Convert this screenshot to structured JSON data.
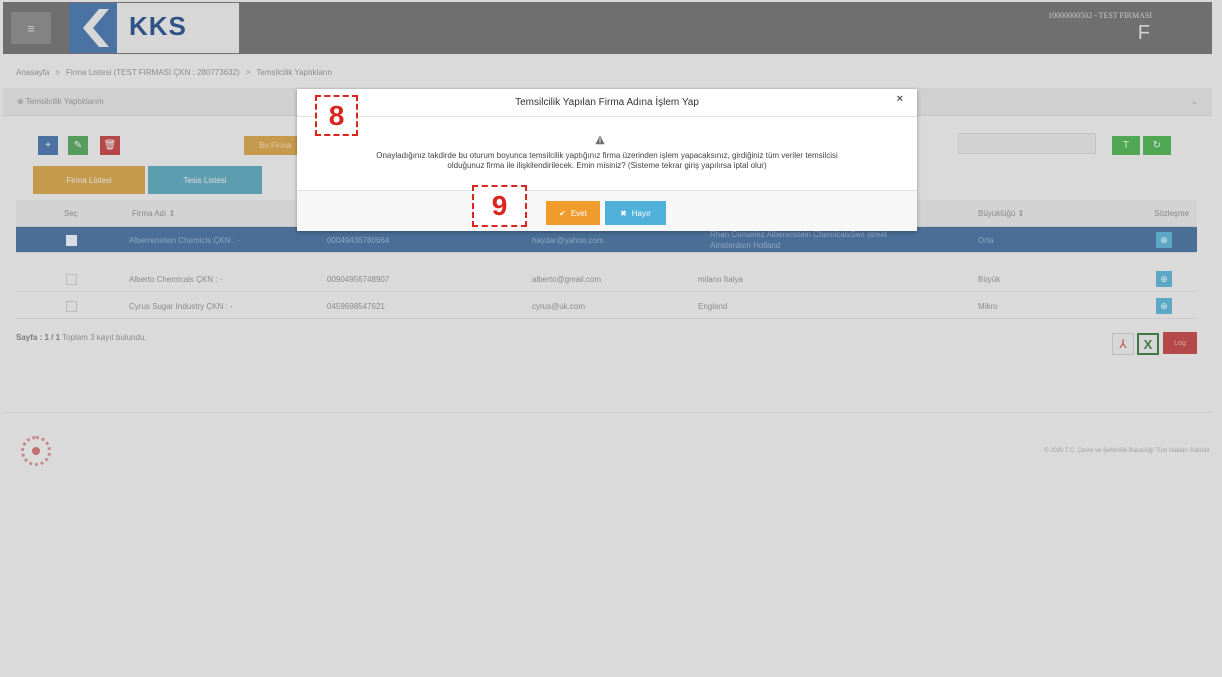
{
  "header": {
    "menu_icon": "≡",
    "logo_text": "KKS",
    "firm_info": "10000000502 - TEST FIRMASI",
    "firm_letter": "F"
  },
  "breadcrumb": {
    "home": "Anasayfa",
    "sep": ">",
    "firm_list": "Firma Listesi (TEST FIRMASI ÇKN : 280773632)",
    "current": "Temsilcilik Yaptıkların"
  },
  "panel": {
    "title": "Temsilcilik Yaptıklarım",
    "chevron": "⌄"
  },
  "toolbar": {
    "add": "+",
    "edit": "✎",
    "delete": "🗑",
    "orange_label": "Bu Firma",
    "filter": "T",
    "refresh": "↻"
  },
  "tabs": [
    {
      "label": "Firma Listesi"
    },
    {
      "label": "Tesis Listesi"
    }
  ],
  "table": {
    "headers": {
      "select": "Seç",
      "name": "Firma Adı ⇕",
      "size": "Büyüklüğü ⇕",
      "contract": "Sözleşme"
    },
    "rows": [
      {
        "name": "Alberrenstein Chemicls ÇKN : -",
        "tax": "00049436780664",
        "email": "haydar@yahoo.com",
        "address": "Rhan Conselez Alberenstein ChemicalsSen street",
        "address2": "Amsterdam Holland",
        "size": "Orta",
        "selected": true
      },
      {
        "name": "Alberto Chemicals ÇKN : -",
        "tax": "00904956748907",
        "email": "alberto@gmail.com",
        "address": "milano İtalya",
        "address2": "",
        "size": "Büyük",
        "selected": false
      },
      {
        "name": "Cyrus Sugar Industry ÇKN : -",
        "tax": "0459698547621",
        "email": "cyrus@uk.com",
        "address": "England",
        "address2": "",
        "size": "Mikro",
        "selected": false
      }
    ]
  },
  "pagination": {
    "page_label": "Sayfa : 1 / 1",
    "total": "Toplam 3 kayıt bulundu."
  },
  "export": {
    "pdf": "⅄",
    "xls": "X",
    "log": "Log"
  },
  "footer": {
    "copyright": "© 2020 T.C. Çevre ve Şehircilik Bakanlığı Tüm Hakları Saklıdır"
  },
  "modal": {
    "title": "Temsilcilik Yapılan Firma Adına İşlem Yap",
    "close": "×",
    "message_line1": "Onayladığınız takdirde bu oturum boyunca temsilcilik yaptığınız firma üzerinden işlem yapacaksınız, girdiğiniz tüm veriler temsilcisi",
    "message_line2": "olduğunuz firma ile ilişkilendirilecek. Emin misiniz? (Sisteme tekrar giriş yapılırsa iptal olur)",
    "yes_icon": "✔",
    "yes_label": "Evet",
    "no_icon": "✖",
    "no_label": "Hayır"
  },
  "steps": {
    "step8": "8",
    "step9": "9"
  }
}
